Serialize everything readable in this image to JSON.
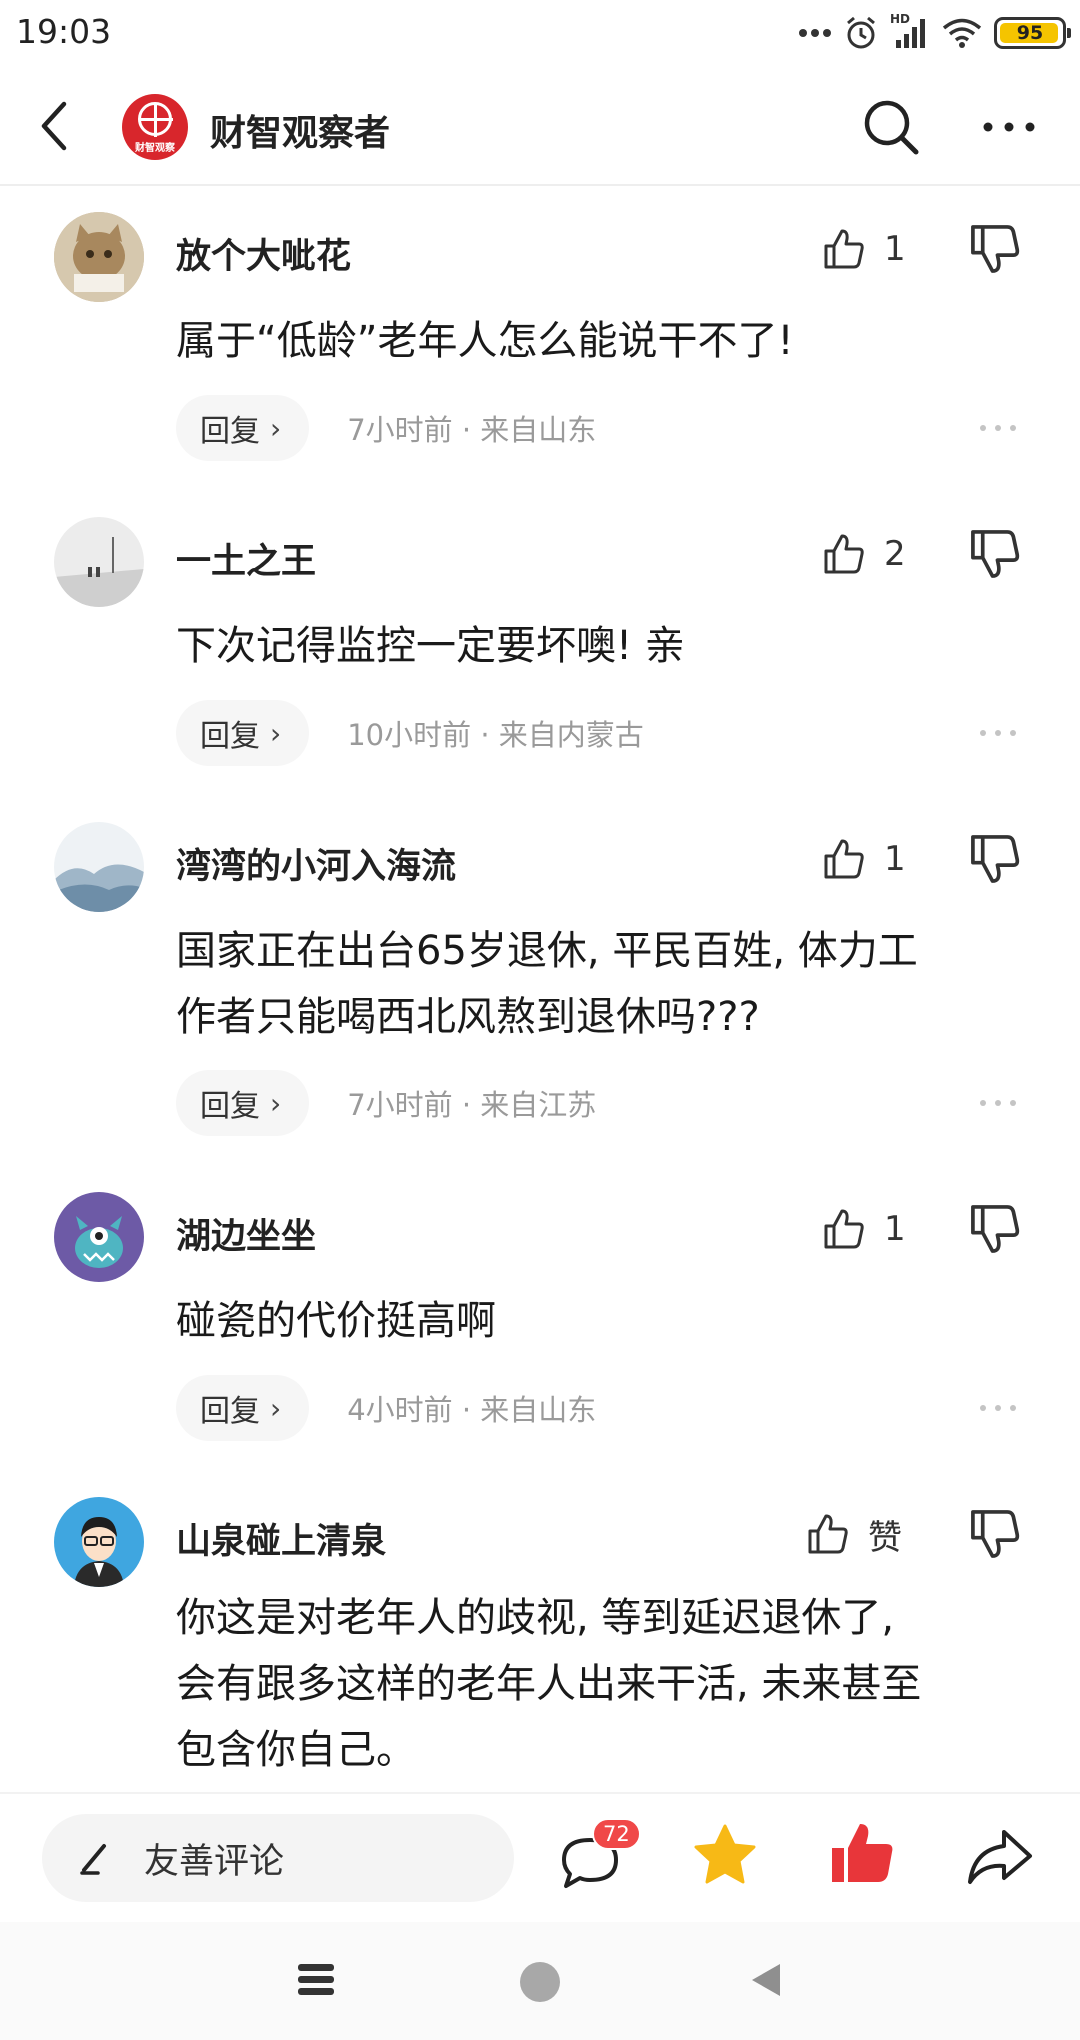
{
  "status_bar": {
    "time": "19:03",
    "signal_label": "HD",
    "battery": "95"
  },
  "header": {
    "channel_name": "财智观察者",
    "logo_text": "财智观察"
  },
  "comments": [
    {
      "username": "放个大呲花",
      "text_lines": [
        "属于“低龄”老年人怎么能说干不了!"
      ],
      "likes": "1",
      "reply_label": "回复",
      "meta": "7小时前 · 来自山东"
    },
    {
      "username": "一土之王",
      "text_lines": [
        "下次记得监控一定要坏噢! 亲"
      ],
      "likes": "2",
      "reply_label": "回复",
      "meta": "10小时前 · 来自内蒙古"
    },
    {
      "username": "湾湾的小河入海流",
      "text_lines": [
        "国家正在出台65岁退休, 平民百姓, 体力工",
        "作者只能喝西北风熬到退休吗???"
      ],
      "likes": "1",
      "reply_label": "回复",
      "meta": "7小时前 · 来自江苏"
    },
    {
      "username": "湖边坐坐",
      "text_lines": [
        "碰瓷的代价挺高啊"
      ],
      "likes": "1",
      "reply_label": "回复",
      "meta": "4小时前 · 来自山东"
    },
    {
      "username": "山泉碰上清泉",
      "text_lines": [
        "你这是对老年人的歧视, 等到延迟退休了,",
        "会有跟多这样的老年人出来干活, 未来甚至",
        "包含你自己。"
      ],
      "likes": "赞"
    }
  ],
  "action_bar": {
    "input_label": "友善评论",
    "comment_count": "72"
  },
  "colors": {
    "accent_red": "#f04848",
    "star": "#f7b916",
    "liked": "#e8363a"
  }
}
